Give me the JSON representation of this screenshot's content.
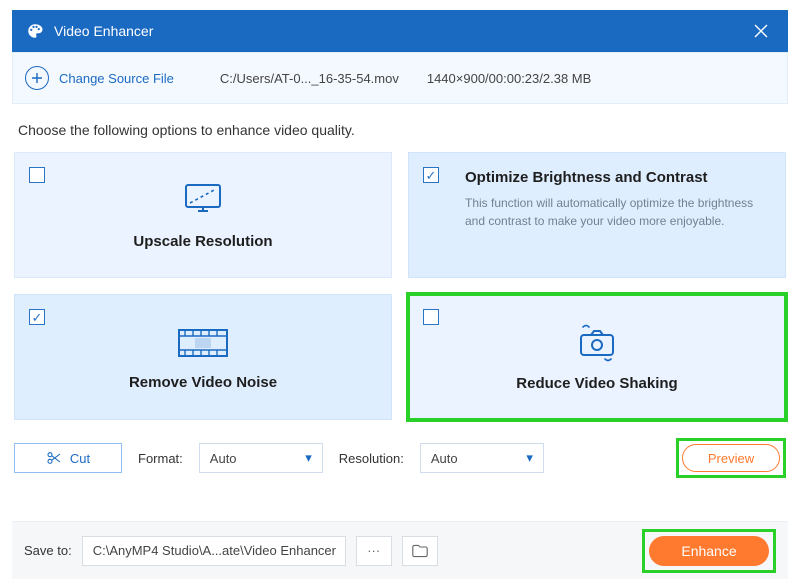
{
  "title": "Video Enhancer",
  "change_source": "Change Source File",
  "source_path": "C:/Users/AT-0..._16-35-54.mov",
  "source_meta": "1440×900/00:00:23/2.38 MB",
  "instruction": "Choose the following options to enhance video quality.",
  "cards": {
    "upscale": {
      "title": "Upscale Resolution"
    },
    "brightness": {
      "title": "Optimize Brightness and Contrast",
      "desc": "This function will automatically optimize the brightness and contrast to make your video more enjoyable."
    },
    "noise": {
      "title": "Remove Video Noise"
    },
    "shaking": {
      "title": "Reduce Video Shaking"
    }
  },
  "cut_label": "Cut",
  "format_label": "Format:",
  "format_value": "Auto",
  "resolution_label": "Resolution:",
  "resolution_value": "Auto",
  "preview_label": "Preview",
  "save_label": "Save to:",
  "save_path": "C:\\AnyMP4 Studio\\A...ate\\Video Enhancer",
  "browse_label": "···",
  "enhance_label": "Enhance"
}
